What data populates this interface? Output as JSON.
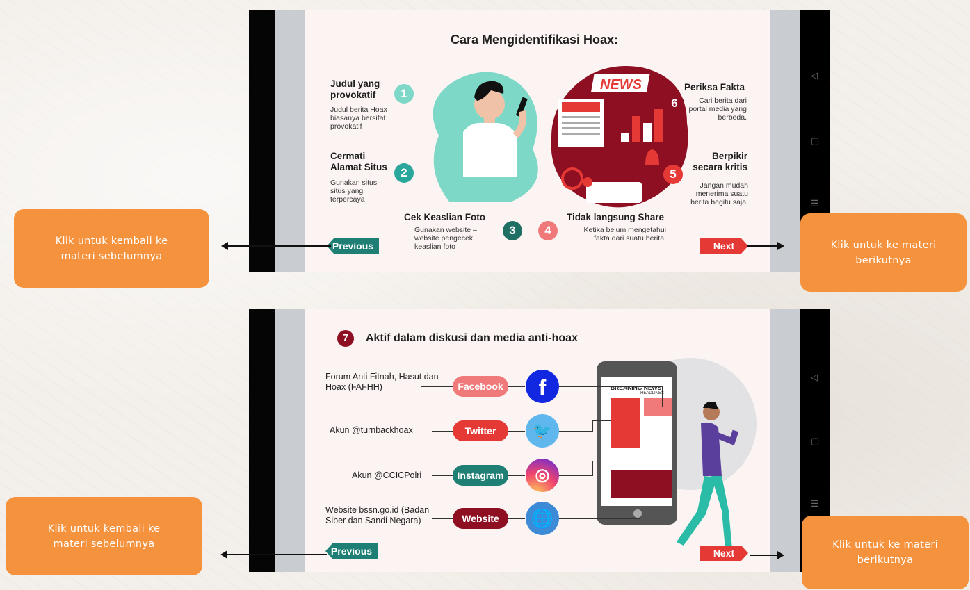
{
  "callouts": {
    "back": "Klik untuk kembali ke materi sebelumnya",
    "next": "Klik untuk ke materi berikutnya"
  },
  "slide1": {
    "title": "Cara Mengidentifikasi Hoax:",
    "news_label": "NEWS",
    "steps": [
      {
        "num": "1",
        "title": "Judul yang provokatif",
        "desc": "Judul berita Hoax biasanya bersifat provokatif"
      },
      {
        "num": "2",
        "title": "Cermati Alamat Situs",
        "desc": "Gunakan situs – situs yang terpercaya"
      },
      {
        "num": "3",
        "title": "Cek Keaslian Foto",
        "desc": "Gunakan website – website pengecek keaslian foto"
      },
      {
        "num": "4",
        "title": "Tidak langsung Share",
        "desc": "Ketika belum mengetahui fakta dari suatu berita."
      },
      {
        "num": "5",
        "title": "Berpikir secara kritis",
        "desc": "Jangan mudah menerima suatu berita begitu saja."
      },
      {
        "num": "6",
        "title": "Periksa Fakta",
        "desc": "Cari berita dari portal media yang berbeda."
      }
    ],
    "prev_label": "Previous",
    "next_label": "Next"
  },
  "slide2": {
    "num": "7",
    "title": "Aktif dalam diskusi dan media anti-hoax",
    "rows": [
      {
        "text": "Forum Anti Fitnah, Hasut dan Hoax (FAFHH)",
        "pill": "Facebook",
        "icon": "facebook-icon"
      },
      {
        "text": "Akun @turnbackhoax",
        "pill": "Twitter",
        "icon": "twitter-icon"
      },
      {
        "text": "Akun @CCICPolri",
        "pill": "Instagram",
        "icon": "instagram-icon"
      },
      {
        "text": "Website bssn.go.id (Badan Siber dan Sandi Negara)",
        "pill": "Website",
        "icon": "globe-icon"
      }
    ],
    "breaking": "BREAKING NEWS",
    "headlines": "HEADLINES",
    "prev_label": "Previous",
    "next_label": "Next"
  },
  "colors": {
    "accent": "#f5923e",
    "teal": "#2aa79b",
    "red": "#e53935",
    "maroon": "#8e0f22"
  }
}
